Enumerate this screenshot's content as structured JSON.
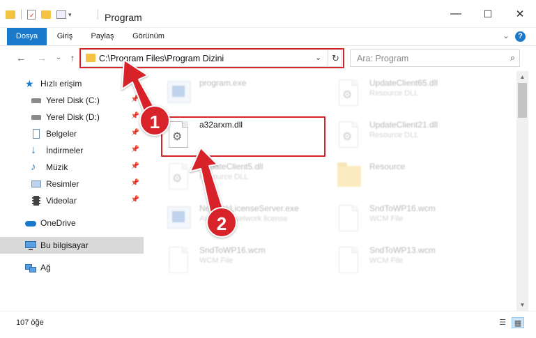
{
  "window": {
    "title": "Program",
    "minimize_glyph": "—",
    "maximize_glyph": "☐",
    "close_glyph": "✕"
  },
  "ribbon": {
    "tabs": [
      {
        "label": "Dosya",
        "active": true
      },
      {
        "label": "Giriş"
      },
      {
        "label": "Paylaş"
      },
      {
        "label": "Görünüm"
      }
    ],
    "help": "?"
  },
  "nav": {
    "back": "←",
    "forward": "→",
    "recent": "⌄",
    "up": "↑"
  },
  "address": {
    "path": "C:\\Program Files\\Program Dizini"
  },
  "search": {
    "placeholder": "Ara: Program"
  },
  "sidebar": {
    "items": [
      {
        "label": "Hızlı erişim",
        "icon": "star-icon"
      },
      {
        "label": "Yerel Disk (C:)",
        "icon": "drive-icon",
        "pinned": true
      },
      {
        "label": "Yerel Disk (D:)",
        "icon": "drive-icon",
        "pinned": true
      },
      {
        "label": "Belgeler",
        "icon": "documents-icon",
        "pinned": true
      },
      {
        "label": "İndirmeler",
        "icon": "download-icon",
        "pinned": true
      },
      {
        "label": "Müzik",
        "icon": "music-icon",
        "pinned": true
      },
      {
        "label": "Resimler",
        "icon": "pictures-icon",
        "pinned": true
      },
      {
        "label": "Videolar",
        "icon": "videos-icon",
        "pinned": true
      },
      {
        "label": "OneDrive",
        "icon": "cloud-icon"
      },
      {
        "label": "Bu bilgisayar",
        "icon": "computer-icon",
        "selected": true
      },
      {
        "label": "Ağ",
        "icon": "network-icon"
      }
    ]
  },
  "files": [
    {
      "name": "program.exe",
      "type": "",
      "icon": "exe-icon",
      "faded": true
    },
    {
      "name": "UpdateClient65.dll",
      "type": "Resource DLL",
      "icon": "dll-icon",
      "faded": true
    },
    {
      "name": "a32arxm.dll",
      "type": "",
      "icon": "dll-icon",
      "faded": false
    },
    {
      "name": "UpdateClient21.dll",
      "type": "Resource DLL",
      "icon": "dll-icon",
      "faded": true
    },
    {
      "name": "UpdateClient5.dll",
      "type": "Resource DLL",
      "icon": "dll-icon",
      "faded": true
    },
    {
      "name": "Resource",
      "type": "",
      "icon": "folder-icon",
      "faded": true
    },
    {
      "name": "NetworkLicenseServer.exe",
      "type": "Autodesk Network license",
      "icon": "exe-icon",
      "faded": true
    },
    {
      "name": "SndToWP16.wcm",
      "type": "WCM File",
      "icon": "file-icon",
      "faded": true
    },
    {
      "name": "SndToWP16.wcm",
      "type": "WCM File",
      "icon": "file-icon",
      "faded": true
    },
    {
      "name": "SndToWP13.wcm",
      "type": "WCM File",
      "icon": "file-icon",
      "faded": true
    }
  ],
  "status": {
    "count": "107 öğe"
  },
  "annotations": {
    "marker1": "1",
    "marker2": "2",
    "accent_red": "#d8232a",
    "accent_blue": "#1979ca"
  }
}
